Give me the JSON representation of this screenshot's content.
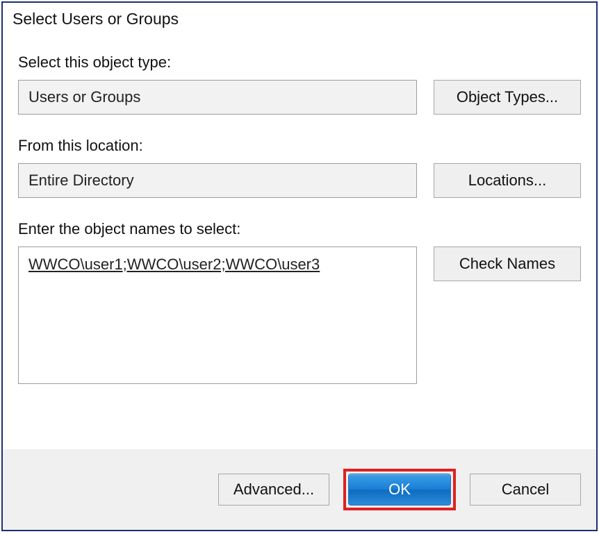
{
  "dialog": {
    "title": "Select Users or Groups",
    "objectType": {
      "label": "Select this object type:",
      "value": "Users or Groups",
      "button": "Object Types..."
    },
    "location": {
      "label": "From this location:",
      "value": "Entire Directory",
      "button": "Locations..."
    },
    "objectNames": {
      "label": "Enter the object names to select:",
      "value": "WWCO\\user1;WWCO\\user2;WWCO\\user3",
      "button": "Check Names"
    },
    "footer": {
      "advanced": "Advanced...",
      "ok": "OK",
      "cancel": "Cancel"
    }
  }
}
